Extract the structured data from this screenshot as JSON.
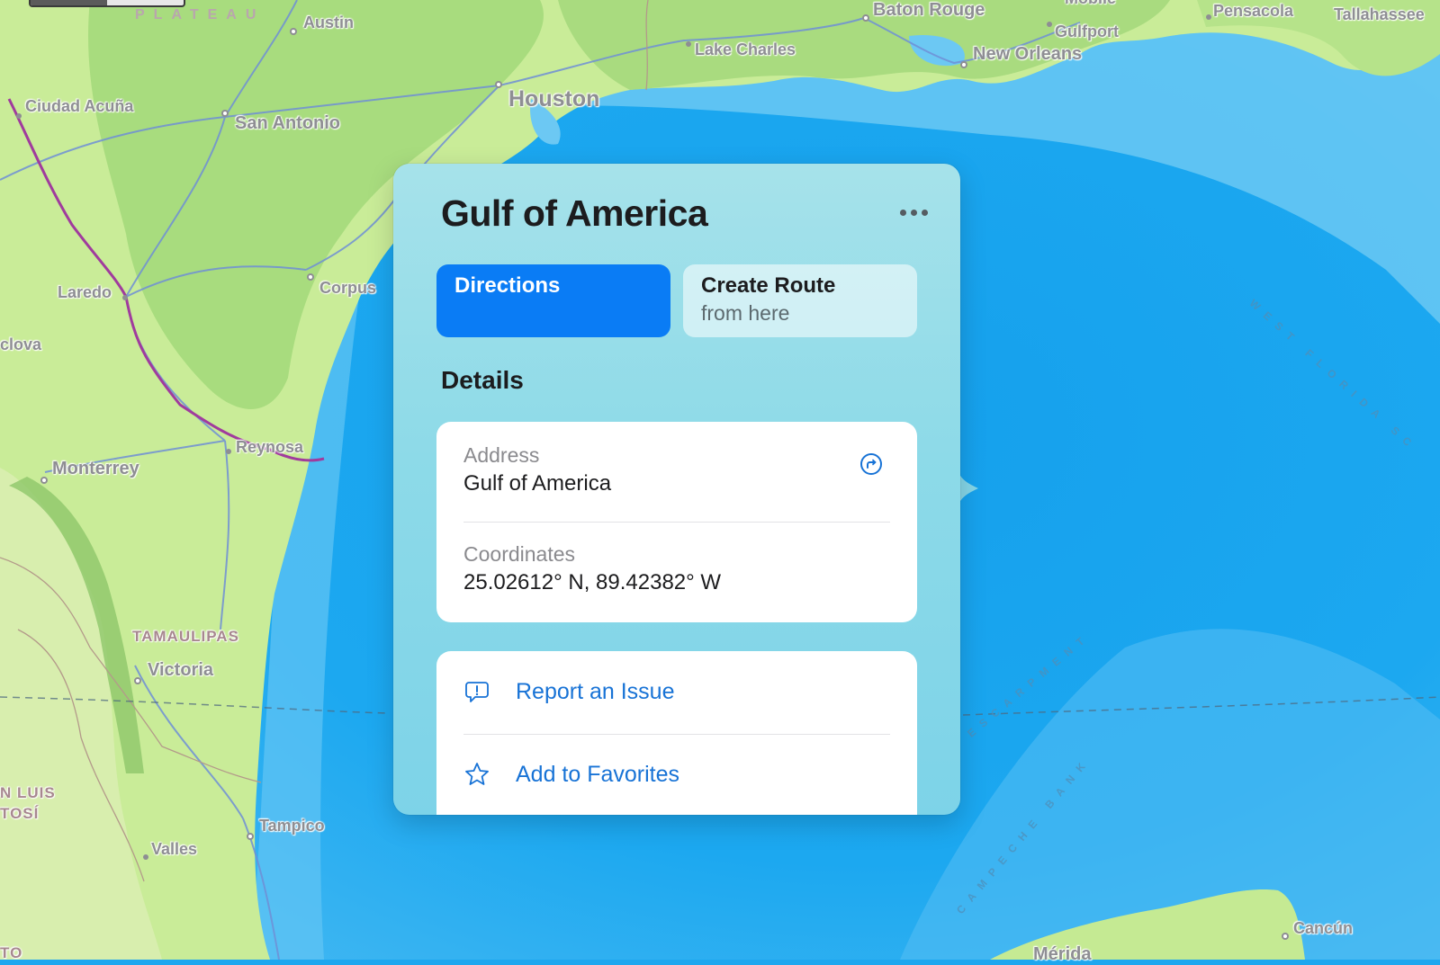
{
  "map": {
    "scale_bar_fill": 0.5,
    "place_labels": [
      {
        "id": "austin",
        "text": "Austin"
      },
      {
        "id": "san-antonio",
        "text": "San Antonio"
      },
      {
        "id": "ciudad-acuna",
        "text": "Ciudad Acuña"
      },
      {
        "id": "houston",
        "text": "Houston"
      },
      {
        "id": "lake-charles",
        "text": "Lake Charles"
      },
      {
        "id": "baton-rouge",
        "text": "Baton Rouge"
      },
      {
        "id": "mobile",
        "text": "Mobile"
      },
      {
        "id": "gulfport",
        "text": "Gulfport"
      },
      {
        "id": "new-orleans",
        "text": "New Orleans"
      },
      {
        "id": "pensacola",
        "text": "Pensacola"
      },
      {
        "id": "tallahassee",
        "text": "Tallahassee"
      },
      {
        "id": "laredo",
        "text": "Laredo"
      },
      {
        "id": "corpus",
        "text": "Corpus"
      },
      {
        "id": "monclova",
        "text": "clova"
      },
      {
        "id": "reynosa",
        "text": "Reynosa"
      },
      {
        "id": "monterrey",
        "text": "Monterrey"
      },
      {
        "id": "victoria",
        "text": "Victoria"
      },
      {
        "id": "tampico",
        "text": "Tampico"
      },
      {
        "id": "valles",
        "text": "Valles"
      },
      {
        "id": "cancun",
        "text": "Cancún"
      },
      {
        "id": "merida",
        "text": "Mérida"
      }
    ],
    "region_labels": [
      {
        "id": "tamaulipas",
        "text": "TAMAULIPAS"
      },
      {
        "id": "san-luis-1",
        "text": "N LUIS"
      },
      {
        "id": "san-luis-2",
        "text": "TOSÍ"
      },
      {
        "id": "guanajuato",
        "text": "TO"
      },
      {
        "id": "plateau",
        "text": "PLATEAU"
      }
    ],
    "sea_labels": [
      {
        "id": "west-florida",
        "text": "WEST FLORIDA SC"
      },
      {
        "id": "escarpment",
        "text": "ESCARPMENT"
      },
      {
        "id": "campeche-bank",
        "text": "CAMPECHE BANK"
      }
    ]
  },
  "popover": {
    "title": "Gulf of America",
    "more_label": "More",
    "buttons": {
      "directions": "Directions",
      "create_route_line1": "Create Route",
      "create_route_line2": "from here"
    },
    "details_heading": "Details",
    "details": [
      {
        "key": "Address",
        "value": "Gulf of America"
      },
      {
        "key": "Coordinates",
        "value": "25.02612° N, 89.42382° W"
      }
    ],
    "actions": [
      {
        "icon": "report-issue-icon",
        "label": "Report an Issue"
      },
      {
        "icon": "star-icon",
        "label": "Add to Favorites"
      }
    ],
    "colors": {
      "accent": "#0a7cf5",
      "link": "#1873d6",
      "panel": "#8ddae8"
    }
  }
}
